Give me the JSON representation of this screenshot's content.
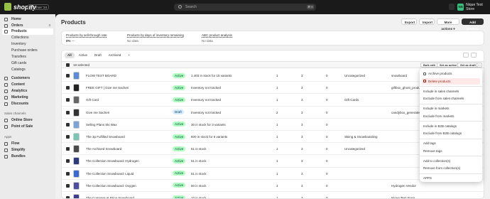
{
  "topbar": {
    "logo": "shopify",
    "edition": "Summer '24",
    "search_placeholder": "Search",
    "shortcut": "⌘ K",
    "store_initials": "NS",
    "store_name": "Nique Test Store"
  },
  "sidebar": {
    "items": [
      {
        "label": "Home",
        "icon": "home-icon"
      },
      {
        "label": "Orders",
        "icon": "orders-icon",
        "badge": "3"
      },
      {
        "label": "Products",
        "icon": "products-icon",
        "active": true
      },
      {
        "label": "Collections",
        "sub": true
      },
      {
        "label": "Inventory",
        "sub": true
      },
      {
        "label": "Purchase orders",
        "sub": true
      },
      {
        "label": "Transfers",
        "sub": true
      },
      {
        "label": "Gift cards",
        "sub": true
      },
      {
        "label": "Catalogs",
        "sub": true
      },
      {
        "label": "Customers",
        "icon": "customers-icon"
      },
      {
        "label": "Content",
        "icon": "content-icon"
      },
      {
        "label": "Analytics",
        "icon": "analytics-icon"
      },
      {
        "label": "Marketing",
        "icon": "marketing-icon"
      },
      {
        "label": "Discounts",
        "icon": "discounts-icon"
      }
    ],
    "sales_channels_title": "Sales channels",
    "sales_channels": [
      {
        "label": "Online Store",
        "icon": "store-icon"
      },
      {
        "label": "Point of Sale",
        "icon": "pos-icon"
      }
    ],
    "apps_title": "Apps",
    "apps": [
      {
        "label": "Flow",
        "icon": "flow-icon"
      },
      {
        "label": "Simplify",
        "icon": "simplify-icon"
      },
      {
        "label": "Bundles",
        "icon": "bundles-icon"
      }
    ]
  },
  "header": {
    "title": "Products",
    "export_label": "Export",
    "import_label": "Import",
    "more_actions_label": "More actions",
    "add_product_label": "Add product"
  },
  "analytics": {
    "sell_through_label": "Products by sell-through rate",
    "sell_through_value": "0%",
    "sell_through_delta": "—",
    "days_inventory_label": "Products by days of inventory remaining",
    "days_inventory_value": "No data",
    "abc_label": "ABC product analysis",
    "abc_value": "No data"
  },
  "tabs": [
    {
      "label": "All",
      "selected": true
    },
    {
      "label": "Active"
    },
    {
      "label": "Draft"
    },
    {
      "label": "Archived"
    },
    {
      "label": "+"
    }
  ],
  "bulk": {
    "selected_text": "18 selected",
    "bulk_edit": "Bulk edit",
    "set_active": "Set as active",
    "set_draft": "Set as draft",
    "more": "···"
  },
  "rows": [
    {
      "name": "FLOW TEST BOARD",
      "status": "Active",
      "inventory": "1,403 in stock for 15 variants",
      "c1": "1",
      "c2": "3",
      "c3": "0",
      "type": "Uncategorized",
      "vendor": "snowboard"
    },
    {
      "name": "FREE GIFT | Give me Sacheri",
      "status": "Active",
      "inventory": "Inventory not tracked",
      "c1": "1",
      "c2": "3",
      "c3": "0",
      "type": "",
      "vendor": "giftbox_ghost_product"
    },
    {
      "name": "Gift Card",
      "status": "Active",
      "inventory": "Inventory not tracked",
      "c1": "1",
      "c2": "3",
      "c3": "0",
      "type": "Gift Cards",
      "vendor": ""
    },
    {
      "name": "Give me Sacheri",
      "status": "Draft",
      "inventory": "Inventory not tracked",
      "c1": "2",
      "c2": "3",
      "c3": "0",
      "type": "",
      "vendor": "candybox_generated"
    },
    {
      "name": "Selling Plans Ski Wax",
      "status": "Active",
      "inventory": "30 in stock for 3 variants",
      "c1": "1",
      "c2": "3",
      "c3": "0",
      "type": "",
      "vendor": ""
    },
    {
      "name": "The 3p Fulfilled Snowboard",
      "status": "Active",
      "inventory": "600 in stock for 6 variants",
      "c1": "1",
      "c2": "3",
      "c3": "0",
      "type": "Skiing & Snowboarding",
      "vendor": ""
    },
    {
      "name": "The Archived Snowboard",
      "status": "Active",
      "inventory": "51 in stock",
      "c1": "1",
      "c2": "3",
      "c3": "0",
      "type": "Uncategorized",
      "vendor": ""
    },
    {
      "name": "The Collection Snowboard: Hydrogen",
      "status": "Active",
      "inventory": "51 in stock",
      "c1": "1",
      "c2": "3",
      "c3": "0",
      "type": "",
      "vendor": ""
    },
    {
      "name": "The Collection Snowboard: Liquid",
      "status": "Active",
      "inventory": "51 in stock",
      "c1": "1",
      "c2": "3",
      "c3": "0",
      "type": "",
      "vendor": ""
    },
    {
      "name": "The Collection Snowboard: Oxygen",
      "status": "Active",
      "inventory": "50 in stock",
      "c1": "1",
      "c2": "3",
      "c3": "0",
      "type": "",
      "vendor": "Hydrogen Vendor"
    },
    {
      "name": "The Compare at Price Snowboard",
      "status": "Active",
      "inventory": "10 in stock",
      "c1": "1",
      "c2": "3",
      "c3": "0",
      "type": "",
      "vendor": "Nique Test Store"
    }
  ],
  "menu": {
    "items": [
      {
        "label": "Archive products",
        "icon": "archive-icon"
      },
      {
        "label": "Delete products",
        "icon": "trash-icon",
        "danger": true
      },
      {
        "label": "Include in sales channels",
        "divider_before": true
      },
      {
        "label": "Exclude from sales channels"
      },
      {
        "label": "Include in markets",
        "divider_before": true
      },
      {
        "label": "Exclude from markets"
      },
      {
        "label": "Include in B2B catalogs",
        "divider_before": true
      },
      {
        "label": "Exclude from B2B catalogs"
      },
      {
        "label": "Add tags",
        "divider_before": true
      },
      {
        "label": "Remove tags"
      },
      {
        "label": "Add to collection(s)",
        "divider_before": true
      },
      {
        "label": "Remove from collection(s)"
      },
      {
        "label": "APPS",
        "divider_before": true
      }
    ]
  },
  "colors": {
    "accent": "#303030",
    "active_badge": "#affebf",
    "draft_badge": "#d5ebff",
    "danger": "#8e1f0b",
    "brand_green": "#95bf47"
  }
}
